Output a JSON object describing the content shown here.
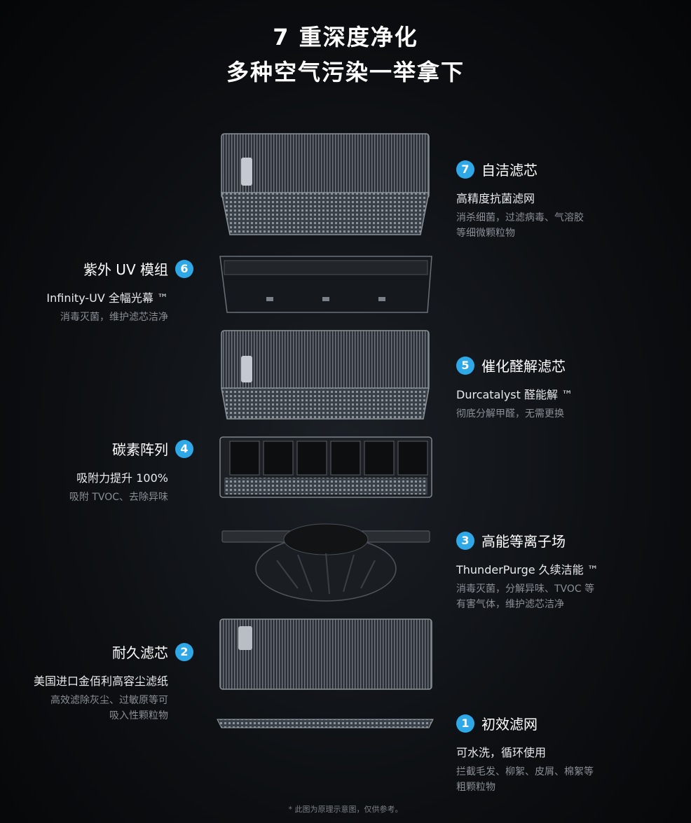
{
  "header": {
    "title_line1": "7 重深度净化",
    "title_line2": "多种空气污染一举拿下"
  },
  "layers": [
    {
      "num": "7",
      "title": "自洁滤芯",
      "subtitle": "高精度抗菌滤网",
      "desc": "消杀细菌，过滤病毒、气溶胶\n等细微颗粒物"
    },
    {
      "num": "6",
      "title": "紫外 UV 模组",
      "subtitle": "Infinity-UV 全幅光幕 ™",
      "desc": "消毒灭菌，维护滤芯洁净"
    },
    {
      "num": "5",
      "title": "催化醛解滤芯",
      "subtitle": "Durcatalyst 醛能解 ™",
      "desc": "彻底分解甲醛，无需更换"
    },
    {
      "num": "4",
      "title": "碳素阵列",
      "subtitle": "吸附力提升 100%",
      "desc": "吸附 TVOC、去除异味"
    },
    {
      "num": "3",
      "title": "高能等离子场",
      "subtitle": "ThunderPurge 久续洁能 ™",
      "desc": "消毒灭菌，分解异味、TVOC 等\n有害气体，维护滤芯洁净"
    },
    {
      "num": "2",
      "title": "耐久滤芯",
      "subtitle": "美国进口金佰利高容尘滤纸",
      "desc": "高效滤除灰尘、过敏原等可\n吸入性颗粒物"
    },
    {
      "num": "1",
      "title": "初效滤网",
      "subtitle": "可水洗，循环使用",
      "desc": "拦截毛发、柳絮、皮屑、棉絮等\n粗颗粒物"
    }
  ],
  "footnote": "* 此图为原理示意图，仅供参考。",
  "colors": {
    "badge": "#2fa8e8",
    "background": "#0c0e11"
  }
}
